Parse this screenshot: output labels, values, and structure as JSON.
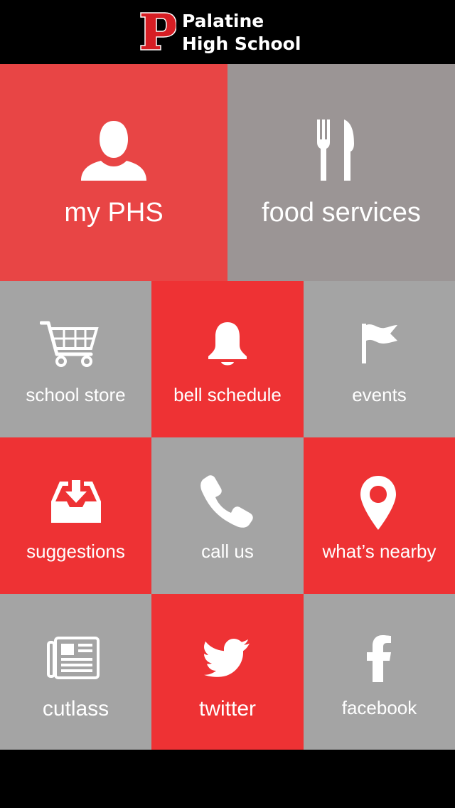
{
  "header": {
    "logo_letter": "P",
    "title_line1": "Palatine",
    "title_line2": "High School"
  },
  "colors": {
    "red_big": "#e84545",
    "gray_big": "#9b9595",
    "red": "#ee3234",
    "gray": "#a4a4a4"
  },
  "tiles": [
    {
      "label": "my PHS",
      "icon": "user-icon"
    },
    {
      "label": "food services",
      "icon": "fork-knife-icon"
    },
    {
      "label": "school store",
      "icon": "shopping-cart-icon"
    },
    {
      "label": "bell schedule",
      "icon": "bell-icon"
    },
    {
      "label": "events",
      "icon": "flag-icon"
    },
    {
      "label": "suggestions",
      "icon": "inbox-download-icon"
    },
    {
      "label": "call us",
      "icon": "phone-icon"
    },
    {
      "label": "what’s nearby",
      "icon": "map-pin-icon"
    },
    {
      "label": "cutlass",
      "icon": "newspaper-icon"
    },
    {
      "label": "twitter",
      "icon": "twitter-bird-icon"
    },
    {
      "label": "facebook",
      "icon": "facebook-icon"
    }
  ]
}
